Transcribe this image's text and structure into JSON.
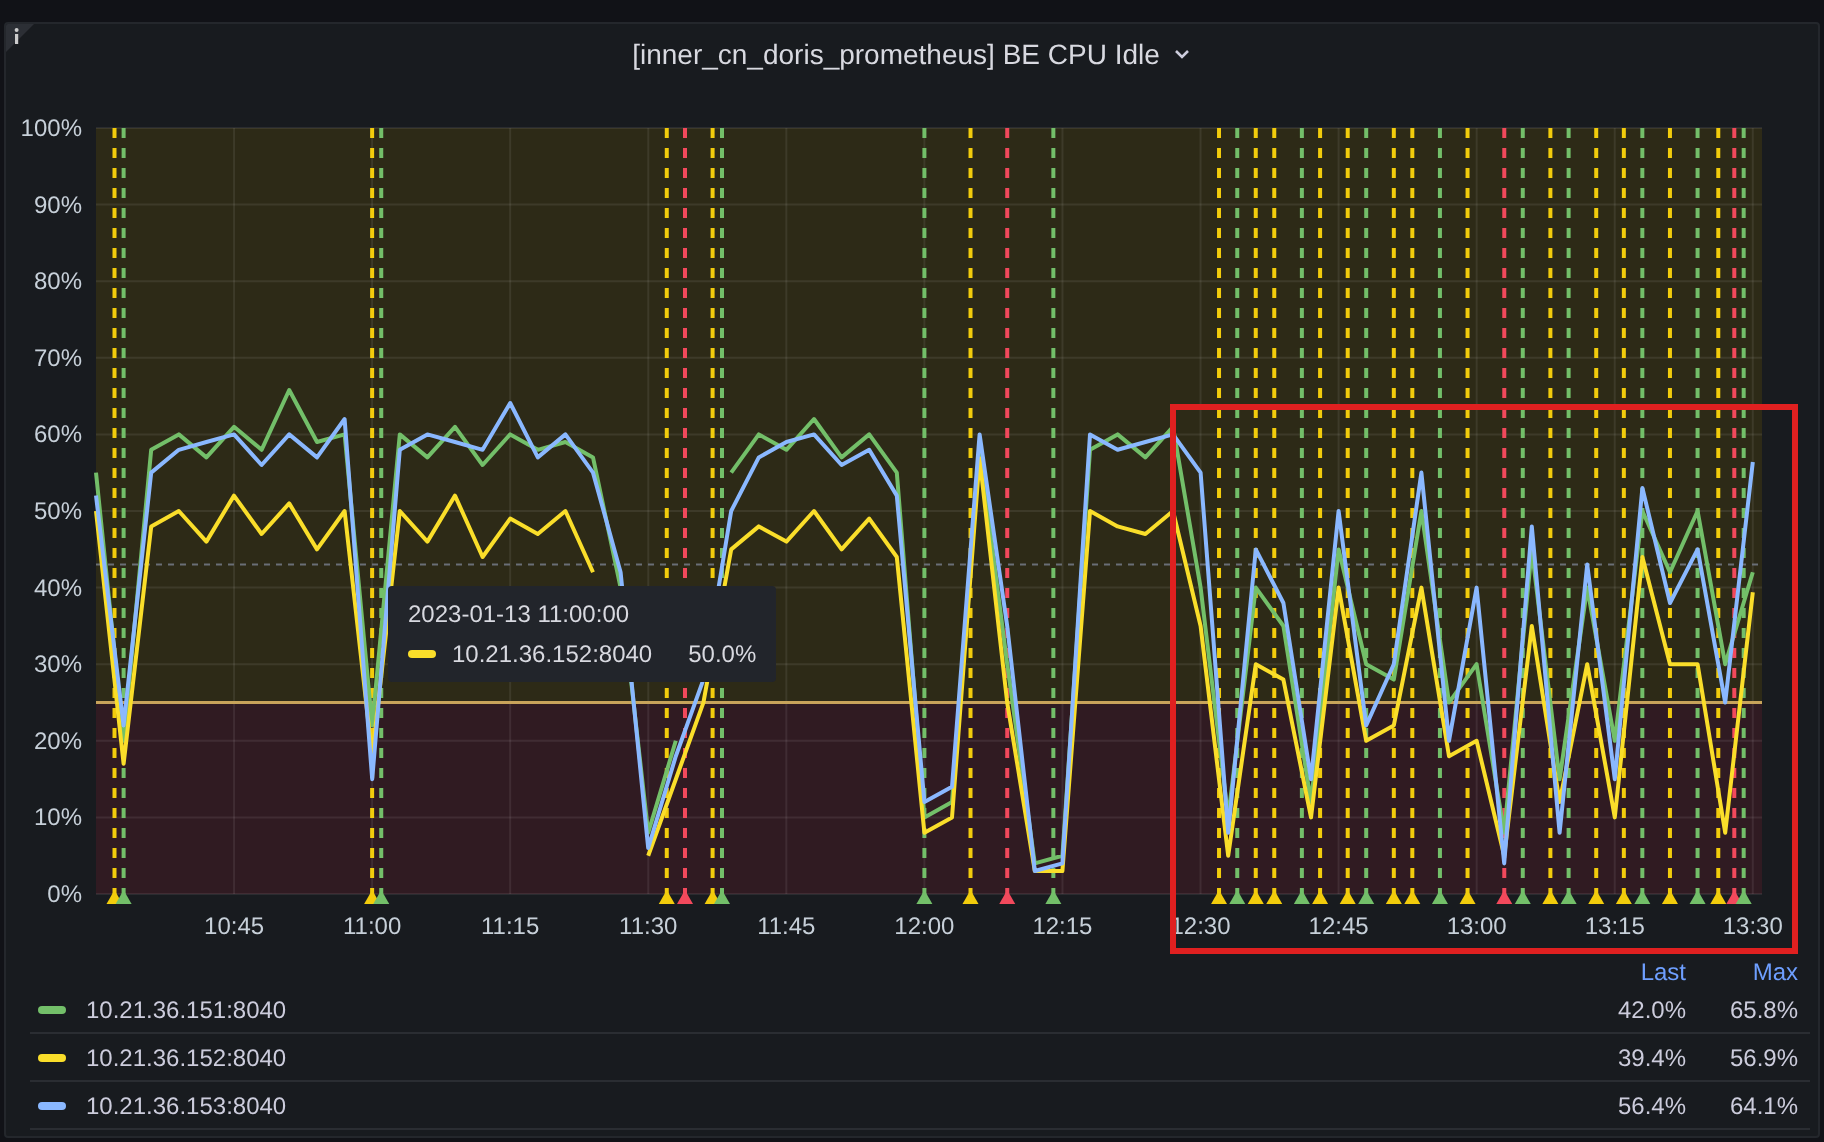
{
  "panel": {
    "title": "[inner_cn_doris_prometheus] BE CPU Idle",
    "chart_data": {
      "type": "line",
      "ylim": [
        0,
        100
      ],
      "categories": [
        null,
        null,
        null,
        null,
        null,
        "10:45",
        null,
        null,
        null,
        null,
        "11:00",
        null,
        null,
        null,
        null,
        "11:15",
        null,
        null,
        null,
        null,
        "11:30",
        null,
        null,
        null,
        null,
        "11:45",
        null,
        null,
        null,
        null,
        "12:00",
        null,
        null,
        null,
        null,
        "12:15",
        null,
        null,
        null,
        null,
        "12:30",
        null,
        null,
        null,
        null,
        "12:45",
        null,
        null,
        null,
        null,
        "13:00",
        null,
        null,
        null,
        null,
        "13:15",
        null,
        null,
        null,
        null,
        "13:30"
      ],
      "yticks": [
        {
          "value": 0,
          "label": "0%"
        },
        {
          "value": 10,
          "label": "10%"
        },
        {
          "value": 20,
          "label": "20%"
        },
        {
          "value": 30,
          "label": "30%"
        },
        {
          "value": 40,
          "label": "40%"
        },
        {
          "value": 50,
          "label": "50%"
        },
        {
          "value": 60,
          "label": "60%"
        },
        {
          "value": 70,
          "label": "70%"
        },
        {
          "value": 80,
          "label": "80%"
        },
        {
          "value": 90,
          "label": "90%"
        },
        {
          "value": 100,
          "label": "100%"
        }
      ],
      "series": [
        {
          "name": "10.21.36.151:8040",
          "color": "#73bf69",
          "values": [
            55,
            20,
            58,
            60,
            57,
            61,
            58,
            65.8,
            59,
            60,
            22,
            60,
            57,
            61,
            56,
            60,
            58,
            59,
            57,
            40,
            8,
            20,
            null,
            55,
            60,
            58,
            62,
            57,
            60,
            55,
            10,
            12,
            58,
            30,
            4,
            5,
            58,
            60,
            57,
            61,
            40,
            10,
            40,
            35,
            12,
            45,
            30,
            28,
            50,
            25,
            30,
            8,
            45,
            15,
            40,
            20,
            50,
            42,
            50,
            30,
            42
          ]
        },
        {
          "name": "10.21.36.152:8040",
          "color": "#fade2a",
          "values": [
            50,
            17,
            48,
            50,
            46,
            52,
            47,
            51,
            45,
            50,
            18,
            50,
            46,
            52,
            44,
            49,
            47,
            50,
            42,
            null,
            5,
            15,
            25,
            45,
            48,
            46,
            50,
            45,
            49,
            44,
            8,
            10,
            56.9,
            25,
            3,
            3,
            50,
            48,
            47,
            50,
            35,
            5,
            30,
            28,
            10,
            40,
            20,
            22,
            40,
            18,
            20,
            5,
            35,
            12,
            30,
            10,
            44,
            30,
            30,
            8,
            39.4
          ]
        },
        {
          "name": "10.21.36.153:8040",
          "color": "#8ab8ff",
          "values": [
            52,
            22,
            55,
            58,
            59,
            60,
            56,
            60,
            57,
            62,
            15,
            58,
            60,
            59,
            58,
            64.1,
            57,
            60,
            55,
            42,
            6,
            18,
            28,
            50,
            57,
            59,
            60,
            56,
            58,
            52,
            12,
            14,
            60,
            35,
            3,
            4,
            60,
            58,
            59,
            60,
            55,
            8,
            45,
            38,
            15,
            50,
            22,
            30,
            55,
            20,
            40,
            4,
            48,
            8,
            43,
            15,
            53,
            38,
            45,
            25,
            56.4
          ]
        }
      ],
      "grid": true,
      "ref_lines": [
        {
          "axis": "y",
          "value": 25,
          "color": "#c8a35a"
        },
        {
          "axis": "y",
          "value": 43,
          "color": "#6a6e76"
        }
      ]
    },
    "tooltip": {
      "time": "2023-01-13 11:00:00",
      "series": "10.21.36.152:8040",
      "color": "#fade2a",
      "value": "50.0%"
    },
    "legend": {
      "columns": [
        "Last",
        "Max"
      ],
      "items": [
        {
          "last": "42.0%",
          "max": "65.8%"
        },
        {
          "last": "39.4%",
          "max": "56.9%"
        },
        {
          "last": "56.4%",
          "max": "64.1%"
        }
      ]
    },
    "highlight": {
      "color": "#e02020"
    }
  }
}
